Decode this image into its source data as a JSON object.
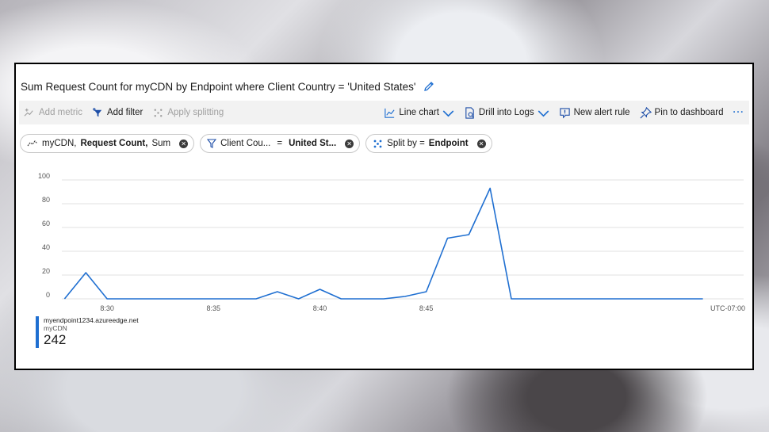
{
  "title": "Sum Request Count for myCDN by Endpoint where Client Country = 'United States'",
  "toolbar": {
    "add_metric": "Add metric",
    "add_filter": "Add filter",
    "apply_splitting": "Apply splitting",
    "line_chart": "Line chart",
    "drill_into_logs": "Drill into Logs",
    "new_alert_rule": "New alert rule",
    "pin_to_dashboard": "Pin to dashboard",
    "more": "···"
  },
  "pills": {
    "metric": {
      "resource": "myCDN,",
      "metric": "Request Count,",
      "agg": "Sum"
    },
    "filter": {
      "label": "Client Cou...",
      "op": "=",
      "value": "United St..."
    },
    "split": {
      "label": "Split by =",
      "value": "Endpoint"
    }
  },
  "chart_data": {
    "type": "line",
    "yticks": [
      0,
      20,
      40,
      60,
      80,
      100
    ],
    "ylim": [
      0,
      100
    ],
    "xtick_labels": [
      "8:30",
      "8:35",
      "8:40",
      "8:45"
    ],
    "timezone": "UTC-07:00",
    "series": [
      {
        "name": "myendpoint1234.azureedge.net",
        "color": "#1f6fd1",
        "x": [
          "8:28",
          "8:29",
          "8:30",
          "8:31",
          "8:32",
          "8:33",
          "8:34",
          "8:35",
          "8:36",
          "8:37",
          "8:38",
          "8:39",
          "8:40",
          "8:41",
          "8:42",
          "8:43",
          "8:44",
          "8:45",
          "8:46",
          "8:47",
          "8:48",
          "8:49",
          "8:50",
          "8:51",
          "8:52",
          "8:53",
          "8:54",
          "8:55",
          "8:56",
          "8:57",
          "8:58"
        ],
        "values": [
          0,
          22,
          0,
          0,
          0,
          0,
          0,
          0,
          0,
          0,
          6,
          0,
          8,
          0,
          0,
          0,
          2,
          6,
          51,
          54,
          93,
          0,
          0,
          0,
          0,
          0,
          0,
          0,
          0,
          0,
          0
        ]
      }
    ]
  },
  "legend": {
    "endpoint": "myendpoint1234.azureedge.net",
    "resource": "myCDN",
    "total": "242"
  }
}
